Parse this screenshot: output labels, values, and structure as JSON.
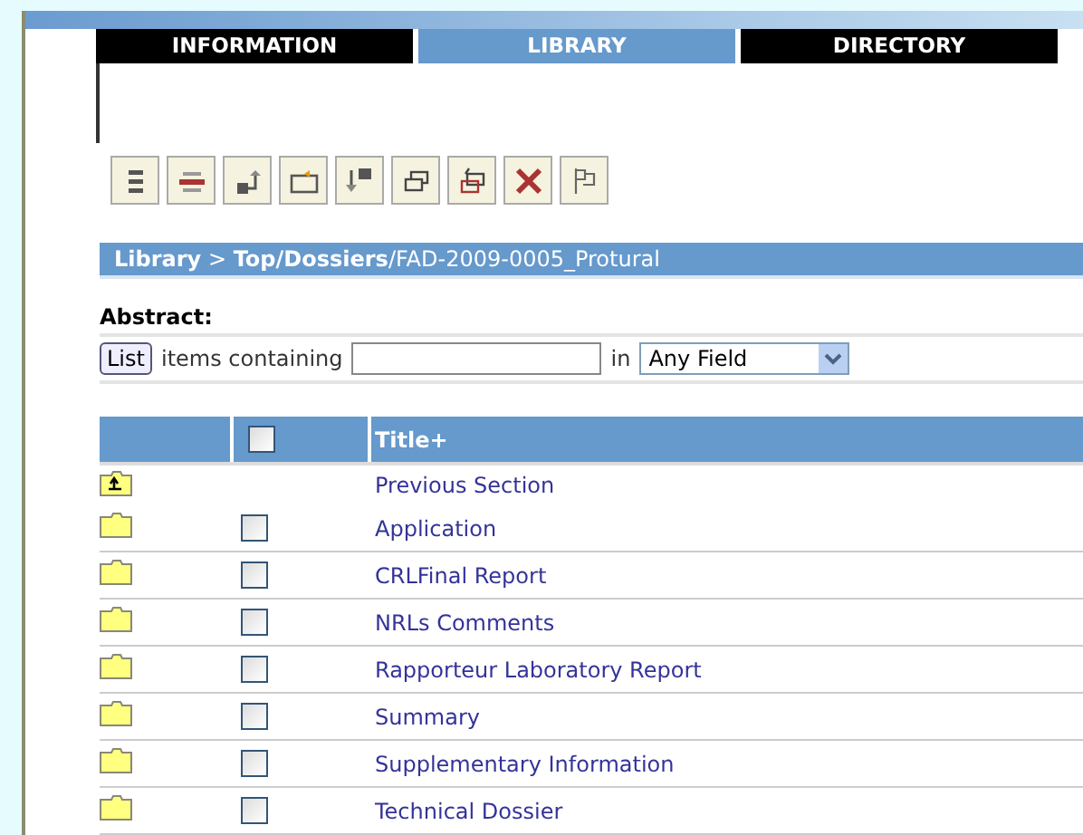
{
  "tabs": [
    {
      "label": "INFORMATION",
      "selected": false
    },
    {
      "label": "LIBRARY",
      "selected": true
    },
    {
      "label": "DIRECTORY",
      "selected": false
    }
  ],
  "toolbar": [
    {
      "kind": "list"
    },
    {
      "kind": "remove"
    },
    {
      "kind": "up"
    },
    {
      "kind": "newfolder"
    },
    {
      "kind": "down"
    },
    {
      "kind": "windows"
    },
    {
      "kind": "move"
    },
    {
      "kind": "delete"
    },
    {
      "kind": "flag"
    }
  ],
  "breadcrumb": {
    "root": "Library",
    "separator": ">",
    "path": "Top/Dossiers",
    "current": "/FAD-2009-0005_Protural"
  },
  "abstract_label": "Abstract:",
  "filter": {
    "button": "List",
    "label": "items containing",
    "in_label": "in",
    "field_select": "Any Field"
  },
  "table": {
    "header_checked": false,
    "title_column": "Title+",
    "rows": [
      {
        "kind": "up",
        "title": "Previous Section"
      },
      {
        "kind": "folder",
        "title": "Application",
        "checked": false
      },
      {
        "kind": "folder",
        "title": "CRLFinal Report",
        "checked": false
      },
      {
        "kind": "folder",
        "title": "NRLs Comments",
        "checked": false
      },
      {
        "kind": "folder",
        "title": "Rapporteur Laboratory Report",
        "checked": false
      },
      {
        "kind": "folder",
        "title": "Summary",
        "checked": false
      },
      {
        "kind": "folder",
        "title": "Supplementary Information",
        "checked": false
      },
      {
        "kind": "folder",
        "title": "Technical Dossier",
        "checked": false
      }
    ]
  }
}
